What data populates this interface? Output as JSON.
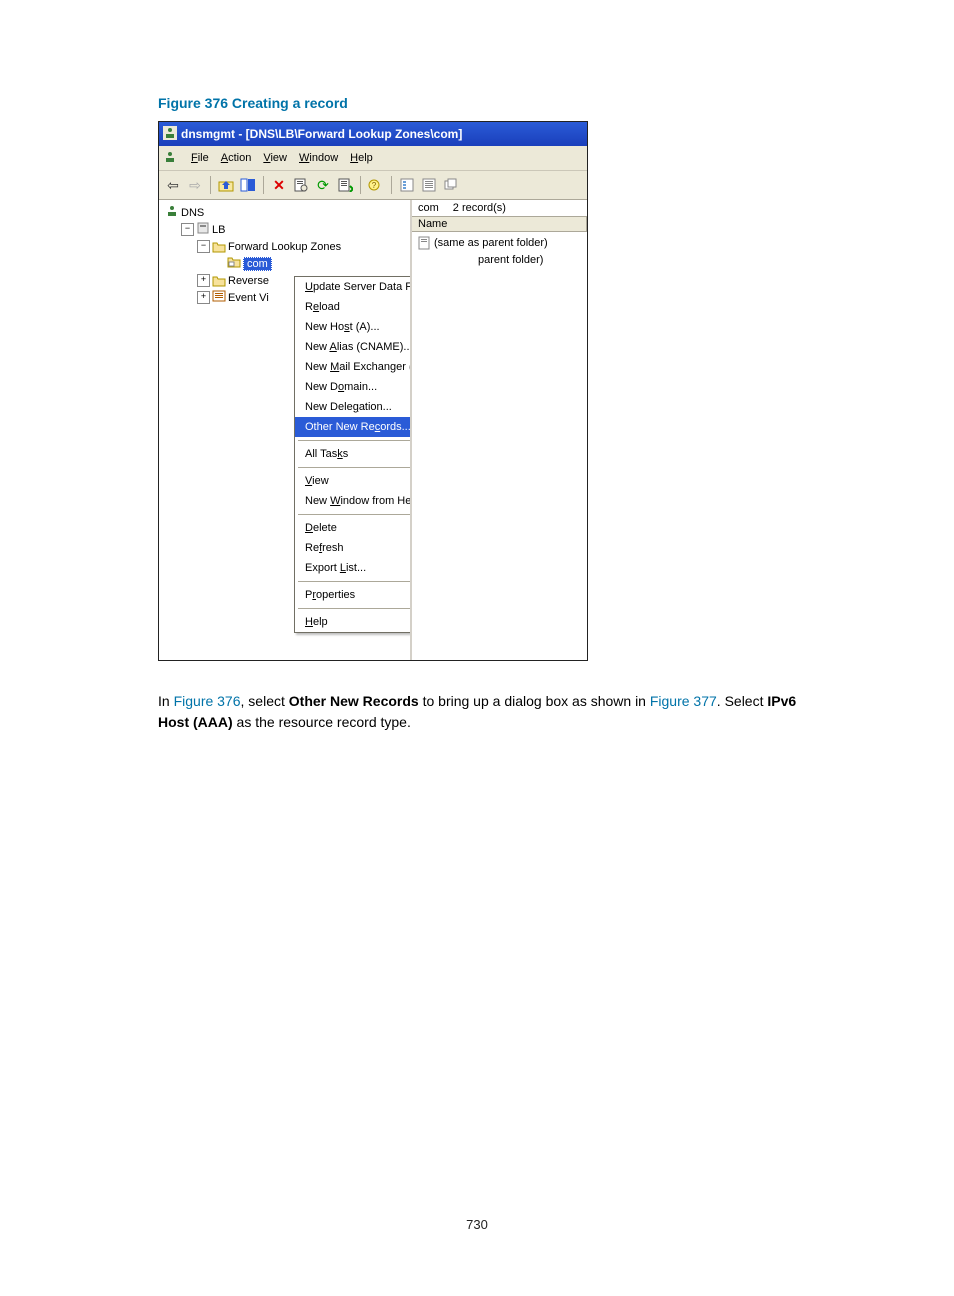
{
  "caption": "Figure 376 Creating a record",
  "window_title": "dnsmgmt - [DNS\\LB\\Forward Lookup Zones\\com]",
  "menus": {
    "file": "File",
    "action": "Action",
    "view": "View",
    "window": "Window",
    "help": "Help"
  },
  "tree": {
    "root": "DNS",
    "lb": "LB",
    "flz": "Forward Lookup Zones",
    "com": "com",
    "reverse": "Reverse",
    "eventv": "Event Vi"
  },
  "right": {
    "header_left": "com",
    "header_right": "2 record(s)",
    "col1": "Name",
    "row1": "(same as parent folder)",
    "row2_fragment": "parent folder)"
  },
  "context": {
    "update": "Update Server Data File",
    "reload": "Reload",
    "newa": "New Host (A)...",
    "cname": "New Alias (CNAME)...",
    "mx": "New Mail Exchanger (MX)...",
    "domain": "New Domain...",
    "delegation": "New Delegation...",
    "other": "Other New Records...",
    "alltasks": "All Tasks",
    "view": "View",
    "newwin": "New Window from Here",
    "delete": "Delete",
    "refresh": "Refresh",
    "export": "Export List...",
    "properties": "Properties",
    "help": "Help"
  },
  "para": {
    "p1_a": "In ",
    "fig376": "Figure 376",
    "p1_b": ", select ",
    "strong1": "Other New Records",
    "p1_c": " to bring up a dialog box as shown in ",
    "fig377": "Figure 377",
    "p1_d": ". Select ",
    "strong2": "IPv6 Host (AAA)",
    "p1_e": " as the resource record type."
  },
  "page_number": "730"
}
